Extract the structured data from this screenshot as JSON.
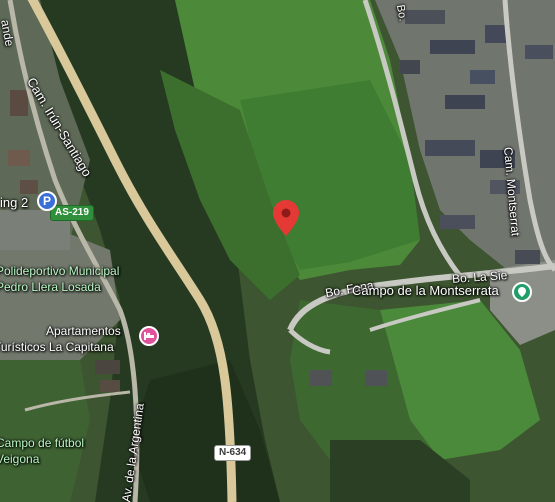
{
  "map": {
    "roads": {
      "camino": "Cam. Irún-Santiago",
      "bo_fana": "Bo. Fana",
      "bo_la_sierra": "Bo. La Sie",
      "cam_montserrat": "Cam. Montserrat",
      "av_argentina": "Av. de la Argentina",
      "top_left_fragment": "ande",
      "top_right_fragment": "Bo."
    },
    "shields": {
      "as219": "AS-219",
      "n634": "N-634"
    },
    "places": {
      "parking": "ing 2",
      "sports_center_line1": "Polideportivo Municipal",
      "sports_center_line2": "Pedro Llera Losada",
      "apartments_line1": "Apartamentos",
      "apartments_line2": "Turísticos La Capitana",
      "football_line1": "Campo de fútbol",
      "football_line2": "Veigona",
      "montserrata": "Campo de la Montserrata"
    },
    "icons": {
      "parking": "parking-icon",
      "apartments": "hotel-icon",
      "montserrata": "place-icon",
      "marker": "location-pin-icon"
    },
    "colors": {
      "parking": "#3b6fd8",
      "apartments": "#e0529b",
      "montserrata": "#1f9e6a",
      "marker": "#e53935"
    }
  }
}
